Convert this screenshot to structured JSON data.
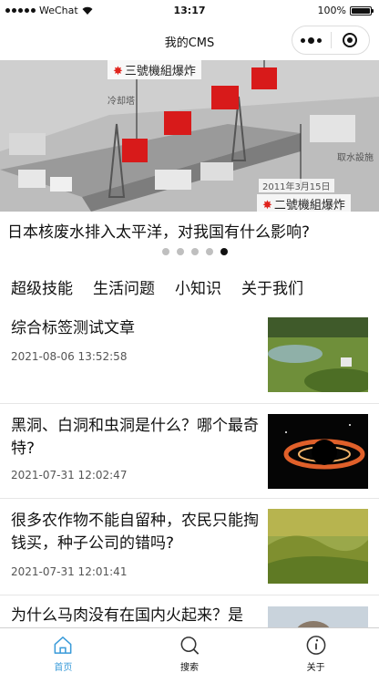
{
  "status_bar": {
    "carrier": "WeChat",
    "time": "13:17",
    "battery": "100%",
    "battery_level": 1.0
  },
  "nav": {
    "title": "我的CMS"
  },
  "banner": {
    "labels": {
      "top": "三號機組爆炸",
      "bottom": "二號機組爆炸",
      "tower": "冷却塔",
      "intake": "取水設施",
      "date": "2011年3月15日"
    },
    "title": "日本核废水排入太平洋，对我国有什么影响?",
    "indicator_count": 5,
    "active_index": 4
  },
  "categories": [
    "超级技能",
    "生活问题",
    "小知识",
    "关于我们"
  ],
  "articles": [
    {
      "title": "综合标签测试文章",
      "date": "2021-08-06 13:52:58"
    },
    {
      "title": "黑洞、白洞和虫洞是什么？哪个最奇特?",
      "date": "2021-07-31 12:02:47"
    },
    {
      "title": "很多农作物不能自留种，农民只能掏钱买，种子公司的错吗?",
      "date": "2021-07-31 12:01:41"
    },
    {
      "title": "为什么马肉没有在国内火起来？是"
    }
  ],
  "tabbar": {
    "items": [
      {
        "label": "首页",
        "icon": "home-icon"
      },
      {
        "label": "搜索",
        "icon": "search-icon"
      },
      {
        "label": "关于",
        "icon": "info-icon"
      }
    ],
    "active_color": "#3a9bd9"
  }
}
